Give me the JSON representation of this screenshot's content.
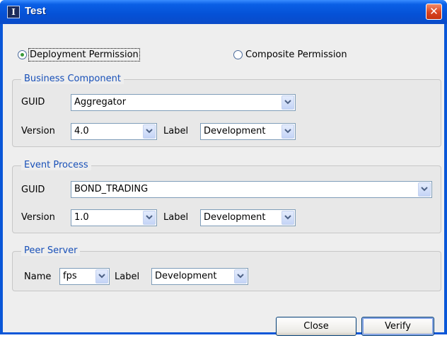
{
  "window": {
    "title": "Test",
    "icon_glyph": "I",
    "close_glyph": "✕"
  },
  "mode": {
    "deployment_label": "Deployment Permission",
    "composite_label": "Composite Permission",
    "selected": "deployment"
  },
  "business_component": {
    "title": "Business Component",
    "guid_label": "GUID",
    "guid_value": "Aggregator",
    "version_label": "Version",
    "version_value": "4.0",
    "label_label": "Label",
    "label_value": "Development"
  },
  "event_process": {
    "title": "Event Process",
    "guid_label": "GUID",
    "guid_value": "BOND_TRADING",
    "version_label": "Version",
    "version_value": "1.0",
    "label_label": "Label",
    "label_value": "Development"
  },
  "peer_server": {
    "title": "Peer Server",
    "name_label": "Name",
    "name_value": "fps",
    "label_label": "Label",
    "label_value": "Development"
  },
  "buttons": {
    "close_label": "Close",
    "verify_label": "Verify"
  },
  "colors": {
    "title_bar": "#0551d6",
    "group_title": "#1850b8",
    "close_button": "#d9431f"
  }
}
